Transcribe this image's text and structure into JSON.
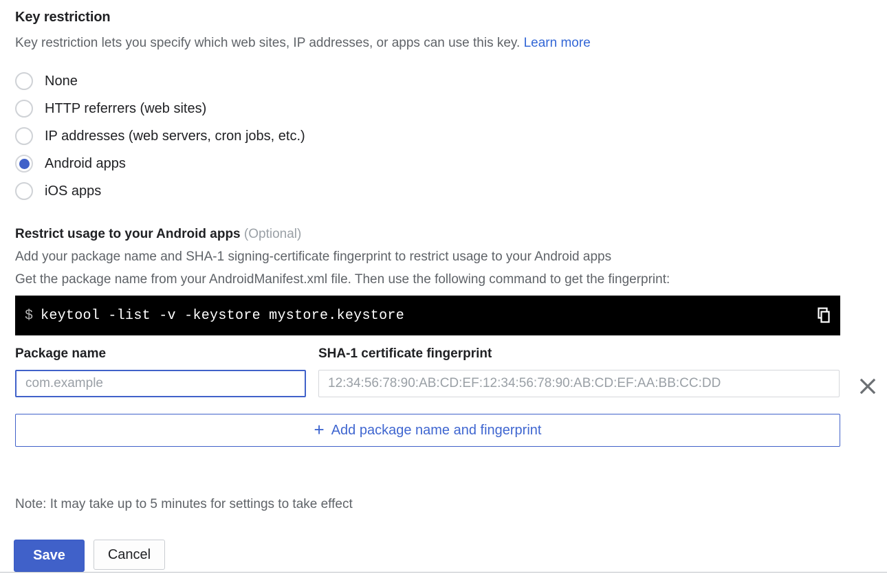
{
  "section": {
    "title": "Key restriction",
    "description": "Key restriction lets you specify which web sites, IP addresses, or apps can use this key.",
    "learn_more": "Learn more"
  },
  "restriction_options": [
    {
      "label": "None",
      "selected": false
    },
    {
      "label": "HTTP referrers (web sites)",
      "selected": false
    },
    {
      "label": "IP addresses (web servers, cron jobs, etc.)",
      "selected": false
    },
    {
      "label": "Android apps",
      "selected": true
    },
    {
      "label": "iOS apps",
      "selected": false
    }
  ],
  "android_section": {
    "title": "Restrict usage to your Android apps",
    "optional": "(Optional)",
    "helper_line_1": "Add your package name and SHA-1 signing-certificate fingerprint to restrict usage to your Android apps",
    "helper_line_2": "Get the package name from your AndroidManifest.xml file. Then use the following command to get the fingerprint:",
    "terminal_prompt": "$",
    "terminal_command": "keytool -list -v -keystore mystore.keystore",
    "copy_icon": "copy-icon"
  },
  "fields": {
    "package_name_label": "Package name",
    "package_name_placeholder": "com.example",
    "package_name_value": "",
    "sha1_label": "SHA-1 certificate fingerprint",
    "sha1_placeholder": "12:34:56:78:90:AB:CD:EF:12:34:56:78:90:AB:CD:EF:AA:BB:CC:DD",
    "sha1_value": "",
    "delete_icon": "close-icon"
  },
  "add_row": {
    "plus": "+",
    "label": "Add package name and fingerprint"
  },
  "footer": {
    "note": "Note: It may take up to 5 minutes for settings to take effect",
    "save_label": "Save",
    "cancel_label": "Cancel"
  },
  "colors": {
    "accent_blue": "#4061c9",
    "link_blue": "#3367d6",
    "text_primary": "#202124",
    "text_secondary": "#5f6368",
    "terminal_bg": "#000000"
  }
}
